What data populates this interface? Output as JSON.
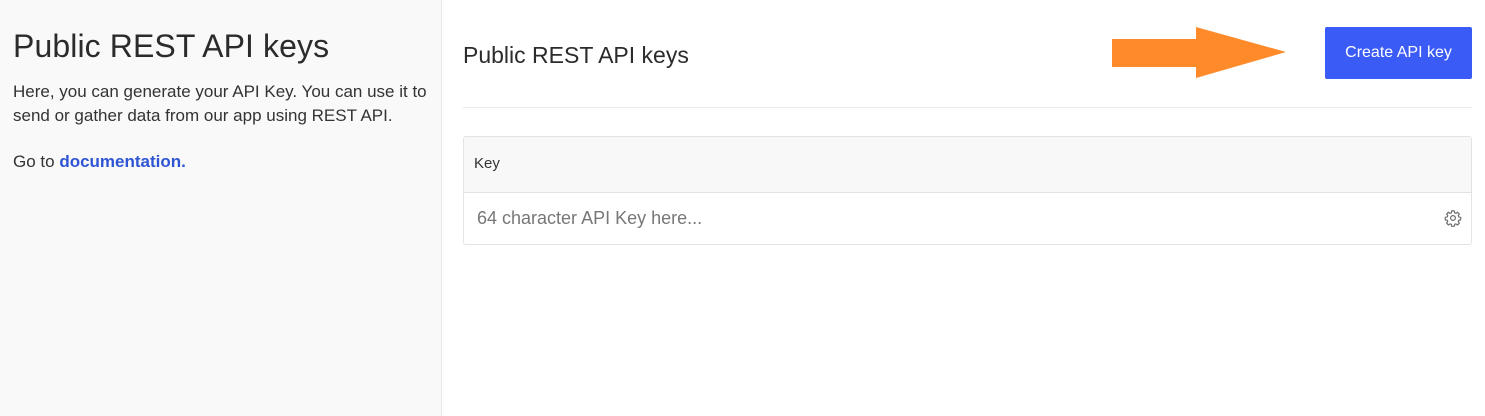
{
  "sidebar": {
    "title": "Public REST API keys",
    "description": "Here, you can generate your API Key. You can use it to send or gather data from our app using REST API.",
    "doc_prefix": "Go to ",
    "doc_link_label": "documentation."
  },
  "header": {
    "title": "Public REST API keys",
    "create_button_label": "Create API key"
  },
  "table": {
    "columns": [
      "Key"
    ],
    "rows": [
      {
        "key": "64 character API Key here..."
      }
    ]
  },
  "colors": {
    "accent": "#3b5bf6",
    "link": "#2f55d4",
    "arrow": "#ff8a2a"
  },
  "icons": {
    "row_action": "gear-icon",
    "annotation": "arrow-right-icon"
  }
}
